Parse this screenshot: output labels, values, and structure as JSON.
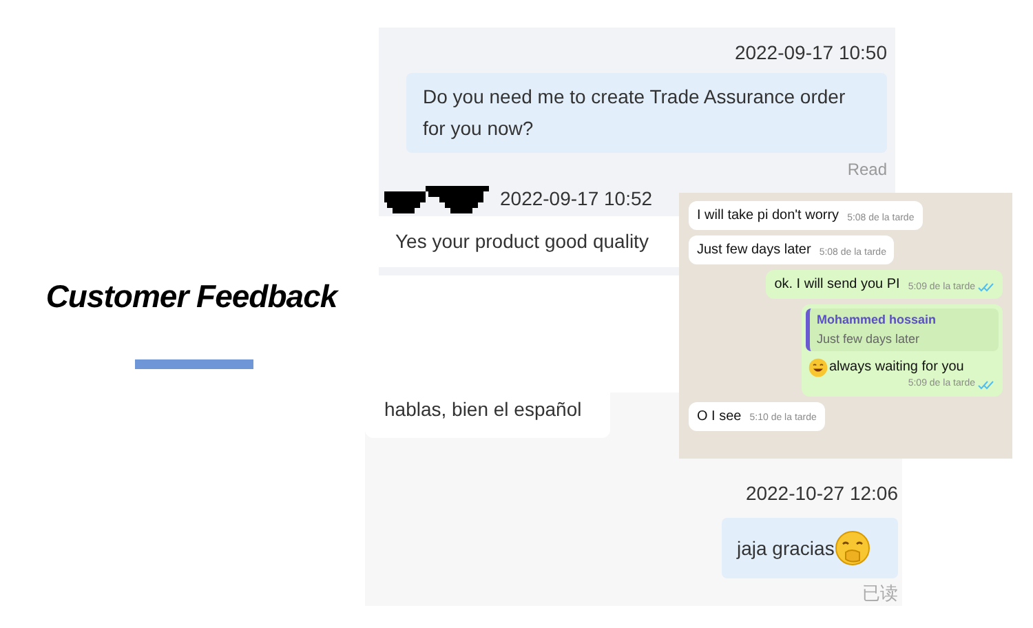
{
  "title": "Customer Feedback",
  "chat_top": {
    "messages": [
      {
        "kind": "outgoing",
        "time": "2022-09-17 10:50",
        "text": "Do you need me to create Trade Assurance order for you now?",
        "status": "Read"
      },
      {
        "kind": "incoming",
        "time": "2022-09-17 10:52",
        "text": "Yes  your product good quality"
      }
    ]
  },
  "chat_bottom": {
    "messages": [
      {
        "kind": "incoming",
        "text": "hablas, bien el español"
      },
      {
        "kind": "outgoing",
        "time": "2022-10-27 12:06",
        "text": "jaja gracias",
        "status": "已读"
      }
    ]
  },
  "whatsapp": {
    "messages": [
      {
        "kind": "incoming",
        "text": "I will take pi don't worry",
        "time": "5:08 de la tarde"
      },
      {
        "kind": "incoming",
        "text": "Just few days later",
        "time": "5:08 de la tarde"
      },
      {
        "kind": "outgoing",
        "text": "ok. I will send you PI",
        "time": "5:09 de la tarde"
      },
      {
        "kind": "reply",
        "quote_author": "Mohammed hossain",
        "quote_text": "Just few days later",
        "text": "always waiting for you",
        "time": "5:09 de la tarde"
      },
      {
        "kind": "incoming",
        "text": "O I see",
        "time": "5:10 de la tarde"
      }
    ]
  }
}
